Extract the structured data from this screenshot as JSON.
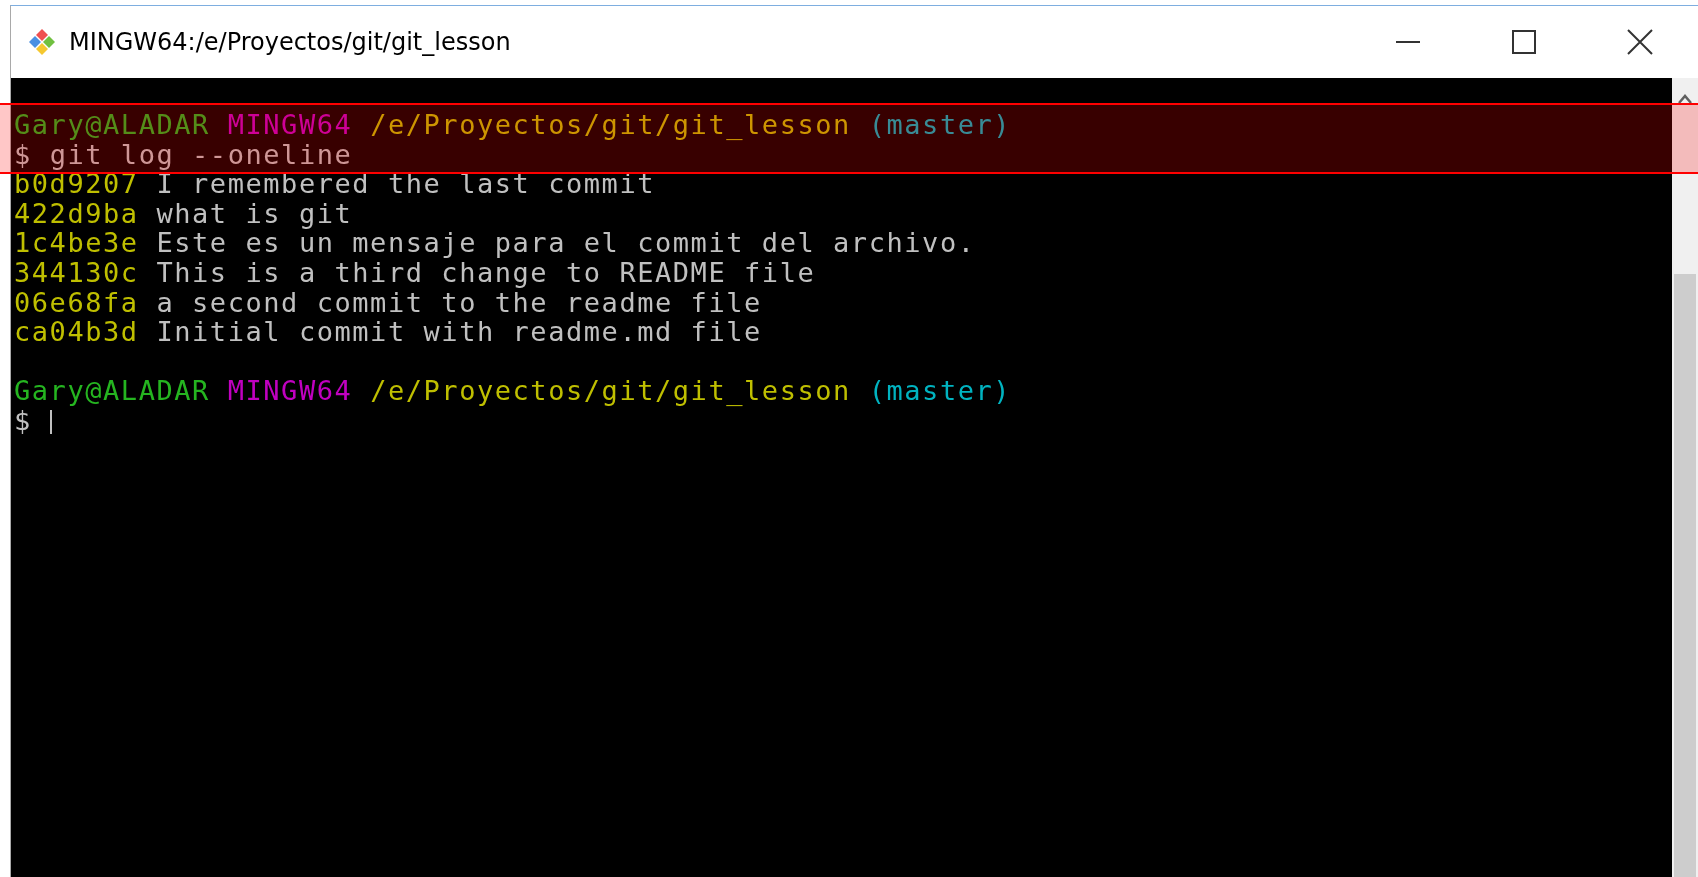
{
  "window": {
    "title": "MINGW64:/e/Proyectos/git/git_lesson"
  },
  "lines": [
    {
      "kind": "prompt",
      "user_host": "Gary@ALADAR",
      "shell": "MINGW64",
      "path": "/e/Proyectos/git/git_lesson",
      "branch": "(master)",
      "highlighted": true
    },
    {
      "kind": "command",
      "symbol": "$",
      "command": "git log --oneline",
      "cursor": false,
      "highlighted": true
    },
    {
      "kind": "commit",
      "hash": "b0d9207",
      "message": "I remembered the last commit",
      "highlighted": false
    },
    {
      "kind": "commit",
      "hash": "422d9ba",
      "message": "what is git",
      "highlighted": false
    },
    {
      "kind": "commit",
      "hash": "1c4be3e",
      "message": "Este es un mensaje para el commit del archivo.",
      "highlighted": false
    },
    {
      "kind": "commit",
      "hash": "344130c",
      "message": "This is a third change to README file",
      "highlighted": false
    },
    {
      "kind": "commit",
      "hash": "06e68fa",
      "message": "a second commit to the readme file",
      "highlighted": false
    },
    {
      "kind": "commit",
      "hash": "ca04b3d",
      "message": "Initial commit with readme.md file",
      "highlighted": false
    },
    {
      "kind": "blank",
      "highlighted": false
    },
    {
      "kind": "prompt",
      "user_host": "Gary@ALADAR",
      "shell": "MINGW64",
      "path": "/e/Proyectos/git/git_lesson",
      "branch": "(master)",
      "highlighted": false
    },
    {
      "kind": "command",
      "symbol": "$",
      "cursor": true,
      "highlighted": false
    }
  ]
}
